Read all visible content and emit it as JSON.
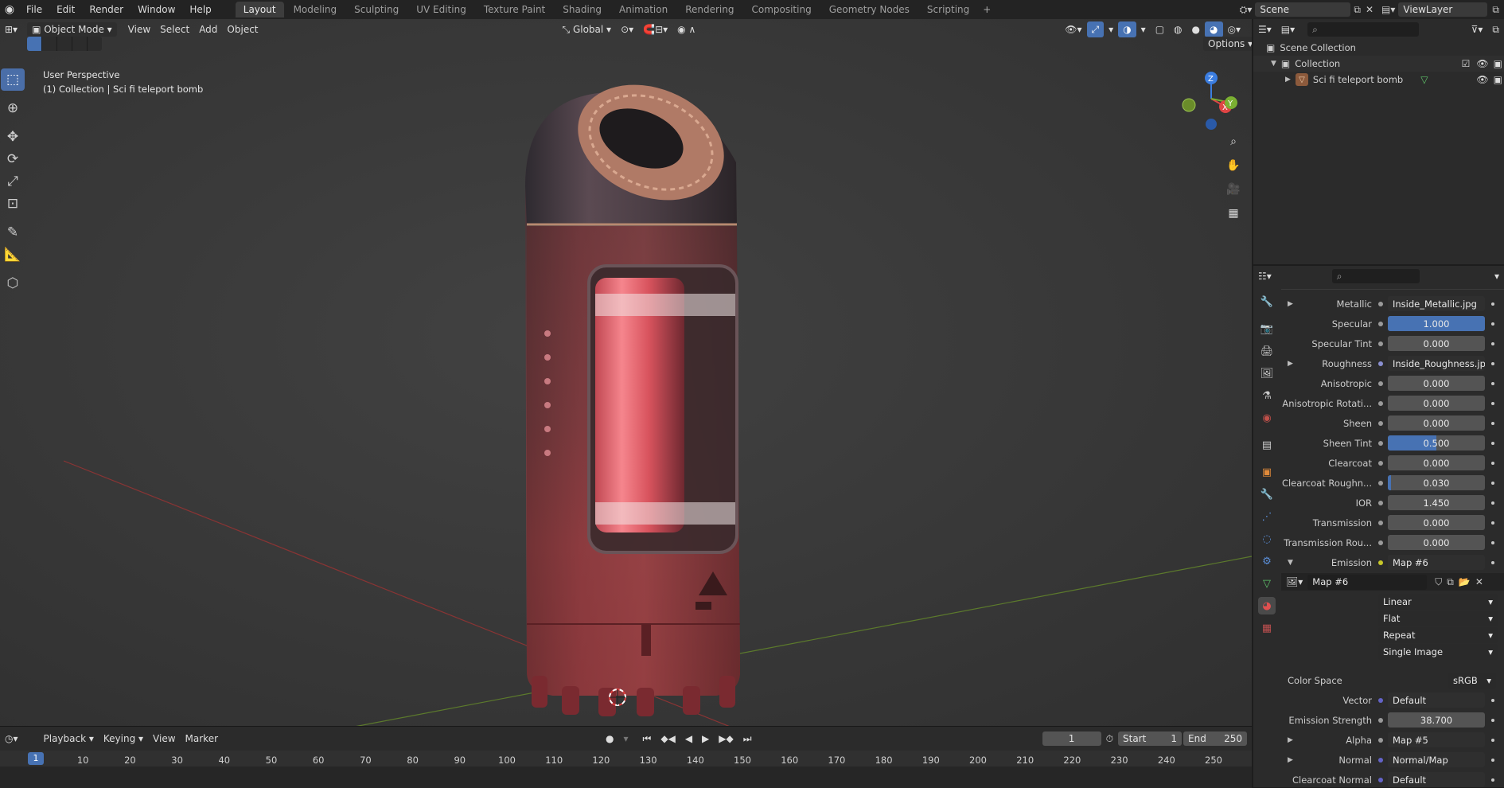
{
  "topbar": {
    "menus": [
      "File",
      "Edit",
      "Render",
      "Window",
      "Help"
    ],
    "workspaces": [
      "Layout",
      "Modeling",
      "Sculpting",
      "UV Editing",
      "Texture Paint",
      "Shading",
      "Animation",
      "Rendering",
      "Compositing",
      "Geometry Nodes",
      "Scripting"
    ],
    "active_workspace": "Layout",
    "scene": "Scene",
    "view_layer": "ViewLayer"
  },
  "viewport_header": {
    "mode": "Object Mode",
    "menus": [
      "View",
      "Select",
      "Add",
      "Object"
    ],
    "orientation": "Global",
    "options": "Options"
  },
  "viewport": {
    "overlay_line1": "User Perspective",
    "overlay_line2": "(1) Collection | Sci fi teleport bomb",
    "gizmo": {
      "z": "Z",
      "y": "Y",
      "x": "X"
    }
  },
  "timeline": {
    "menus": [
      "Playback",
      "Keying",
      "View",
      "Marker"
    ],
    "current_frame": "1",
    "start_label": "Start",
    "start": "1",
    "end_label": "End",
    "end": "250",
    "ticks": [
      "10",
      "20",
      "30",
      "40",
      "50",
      "60",
      "70",
      "80",
      "90",
      "100",
      "110",
      "120",
      "130",
      "140",
      "150",
      "160",
      "170",
      "180",
      "190",
      "200",
      "210",
      "220",
      "230",
      "240",
      "250"
    ],
    "cursor": "1"
  },
  "outliner": {
    "items": [
      {
        "label": "Scene Collection"
      },
      {
        "label": "Collection"
      },
      {
        "label": "Sci fi teleport bomb"
      }
    ]
  },
  "properties": {
    "rows": [
      {
        "label": "Metallic",
        "value": "Inside_Metallic.jpg",
        "kind": "link",
        "arrow": "▶",
        "dot": "#9a9a9a"
      },
      {
        "label": "Specular",
        "value": "1.000",
        "kind": "blue",
        "fill": 1.0,
        "dot": "#9a9a9a"
      },
      {
        "label": "Specular Tint",
        "value": "0.000",
        "kind": "num",
        "dot": "#9a9a9a"
      },
      {
        "label": "Roughness",
        "value": "Inside_Roughness.jpg",
        "kind": "link",
        "arrow": "▶",
        "dot": "#8a8fd0"
      },
      {
        "label": "Anisotropic",
        "value": "0.000",
        "kind": "num",
        "dot": "#9a9a9a"
      },
      {
        "label": "Anisotropic Rotati...",
        "value": "0.000",
        "kind": "num",
        "dot": "#9a9a9a"
      },
      {
        "label": "Sheen",
        "value": "0.000",
        "kind": "num",
        "dot": "#9a9a9a"
      },
      {
        "label": "Sheen Tint",
        "value": "0.500",
        "kind": "blue",
        "fill": 0.5,
        "dot": "#9a9a9a"
      },
      {
        "label": "Clearcoat",
        "value": "0.000",
        "kind": "num",
        "dot": "#9a9a9a"
      },
      {
        "label": "Clearcoat Roughn...",
        "value": "0.030",
        "kind": "num",
        "fill": 0.03,
        "dot": "#9a9a9a"
      },
      {
        "label": "IOR",
        "value": "1.450",
        "kind": "num",
        "dot": "#9a9a9a"
      },
      {
        "label": "Transmission",
        "value": "0.000",
        "kind": "num",
        "dot": "#9a9a9a"
      },
      {
        "label": "Transmission Rou...",
        "value": "0.000",
        "kind": "num",
        "dot": "#9a9a9a"
      },
      {
        "label": "Emission",
        "value": "Map #6",
        "kind": "link",
        "arrow": "▼",
        "dot": "#c7c729"
      }
    ],
    "map_name": "Map #6",
    "dropdowns": [
      "Linear",
      "Flat",
      "Repeat",
      "Single Image"
    ],
    "color_space_label": "Color Space",
    "color_space": "sRGB",
    "rows2": [
      {
        "label": "Vector",
        "value": "Default",
        "kind": "link",
        "dot": "#6363c7"
      },
      {
        "label": "Emission Strength",
        "value": "38.700",
        "kind": "num",
        "dot": "#9a9a9a"
      },
      {
        "label": "Alpha",
        "value": "Map #5",
        "kind": "link",
        "arrow": "▶",
        "dot": "#9a9a9a"
      },
      {
        "label": "Normal",
        "value": "Normal/Map",
        "kind": "link",
        "arrow": "▶",
        "dot": "#6363c7"
      },
      {
        "label": "Clearcoat Normal",
        "value": "Default",
        "kind": "link",
        "dot": "#6363c7"
      }
    ]
  },
  "colors": {
    "accent": "#4772b3",
    "viewport": "#393939",
    "panel": "#2b2b2b"
  }
}
